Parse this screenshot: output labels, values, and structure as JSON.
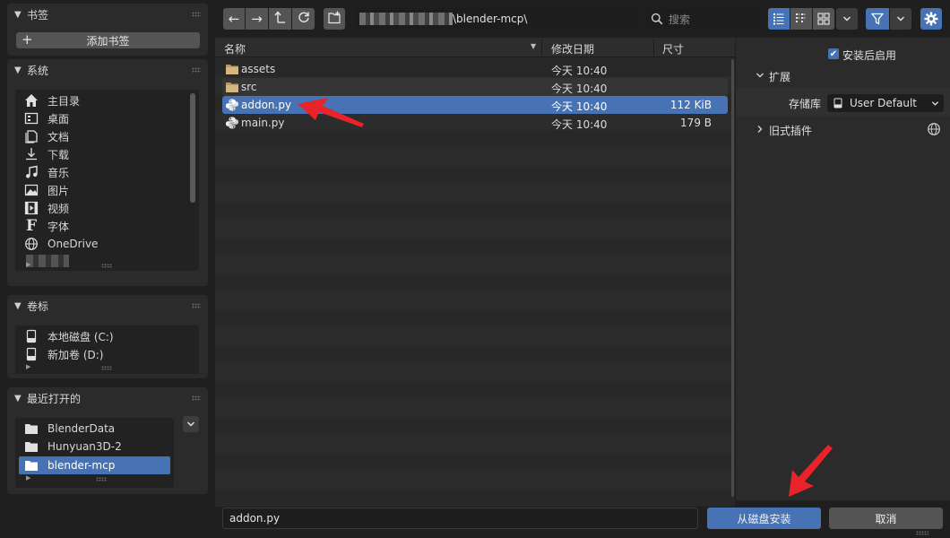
{
  "sidebar": {
    "bookmarks": {
      "title": "书签",
      "add_label": "添加书签"
    },
    "system": {
      "title": "系统",
      "items": [
        {
          "label": "主目录",
          "icon": "home-icon"
        },
        {
          "label": "桌面",
          "icon": "desktop-icon"
        },
        {
          "label": "文档",
          "icon": "documents-icon"
        },
        {
          "label": "下载",
          "icon": "download-icon"
        },
        {
          "label": "音乐",
          "icon": "music-icon"
        },
        {
          "label": "图片",
          "icon": "image-icon"
        },
        {
          "label": "视频",
          "icon": "video-icon"
        },
        {
          "label": "字体",
          "icon": "font-icon"
        },
        {
          "label": "OneDrive",
          "icon": "globe-icon"
        }
      ]
    },
    "volumes": {
      "title": "卷标",
      "items": [
        {
          "label": "本地磁盘 (C:)",
          "icon": "disk-icon"
        },
        {
          "label": "新加卷 (D:)",
          "icon": "disk-icon"
        }
      ]
    },
    "recent": {
      "title": "最近打开的",
      "items": [
        {
          "label": "BlenderData",
          "icon": "folder-icon"
        },
        {
          "label": "Hunyuan3D-2",
          "icon": "folder-icon"
        },
        {
          "label": "blender-mcp",
          "icon": "folder-icon",
          "selected": true
        }
      ]
    }
  },
  "toolbar": {
    "path_value": "\\blender-mcp\\",
    "search_placeholder": "搜索"
  },
  "file_list": {
    "columns": {
      "name": "名称",
      "date": "修改日期",
      "size": "尺寸"
    },
    "rows": [
      {
        "name": "assets",
        "date": "今天 10:40",
        "size": "",
        "icon": "folder-icon"
      },
      {
        "name": "src",
        "date": "今天 10:40",
        "size": "",
        "icon": "folder-icon"
      },
      {
        "name": "addon.py",
        "date": "今天 10:40",
        "size": "112 KiB",
        "icon": "python-icon",
        "selected": true
      },
      {
        "name": "main.py",
        "date": "今天 10:40",
        "size": "179 B",
        "icon": "python-icon"
      }
    ]
  },
  "options": {
    "enable_after_install_label": "安装后启用",
    "enable_after_install": true,
    "extensions_section": "扩展",
    "repository_label": "存储库",
    "repository_value": "User Default",
    "legacy_addons_section": "旧式插件"
  },
  "bottom": {
    "filename_value": "addon.py",
    "install_label": "从磁盘安装",
    "cancel_label": "取消"
  },
  "colors": {
    "accent": "#4772b3",
    "annotation_arrow": "#e8232a"
  }
}
